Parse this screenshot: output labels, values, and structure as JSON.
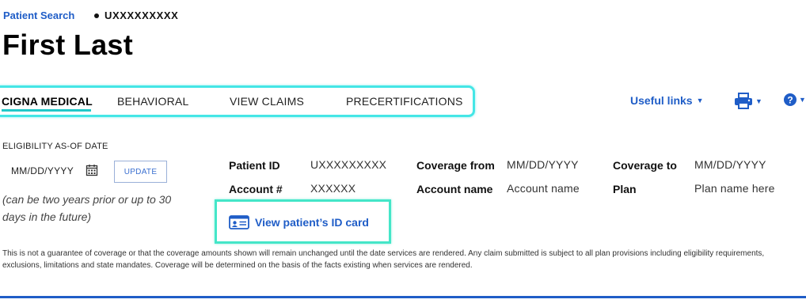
{
  "breadcrumb": {
    "link": "Patient Search",
    "patient_id": "UXXXXXXXXX"
  },
  "title": "First Last",
  "tabs": [
    {
      "label": "CIGNA MEDICAL",
      "active": true
    },
    {
      "label": "BEHAVIORAL",
      "active": false
    },
    {
      "label": "VIEW CLAIMS",
      "active": false
    },
    {
      "label": "PRECERTIFICATIONS",
      "active": false
    }
  ],
  "toolbar": {
    "useful_links": "Useful links",
    "print_icon": "printer-icon",
    "help_icon": "help-icon"
  },
  "eligibility": {
    "label": "ELIGIBILITY AS-OF DATE",
    "date_value": "MM/DD/YYYY",
    "calendar_icon": "calendar-icon",
    "update_label": "UPDATE",
    "hint": "(can be two years prior or up to 30 days in the future)"
  },
  "details": {
    "patient_id_label": "Patient ID",
    "patient_id_value": "UXXXXXXXXX",
    "account_label": "Account #",
    "account_value": "XXXXXX",
    "coverage_from_label": "Coverage from",
    "coverage_from_value": "MM/DD/YYYY",
    "account_name_label": "Account name",
    "account_name_value": "Account name",
    "coverage_to_label": "Coverage to",
    "coverage_to_value": "MM/DD/YYYY",
    "plan_label": "Plan",
    "plan_value": "Plan name here"
  },
  "id_card": {
    "label": "View patient’s ID card",
    "icon": "id-card-icon"
  },
  "disclaimer": "This is not a guarantee of coverage or that the coverage amounts shown will remain unchanged until the date services are rendered. Any claim submitted is subject to all plan provisions including eligibility requirements, exclusions, limitations and state mandates. Coverage will be determined on the basis of the facts existing when services are rendered.",
  "colors": {
    "link_blue": "#1f5dc7",
    "highlight_teal": "#44e6e6",
    "tab_underline": "#22c8c8"
  }
}
